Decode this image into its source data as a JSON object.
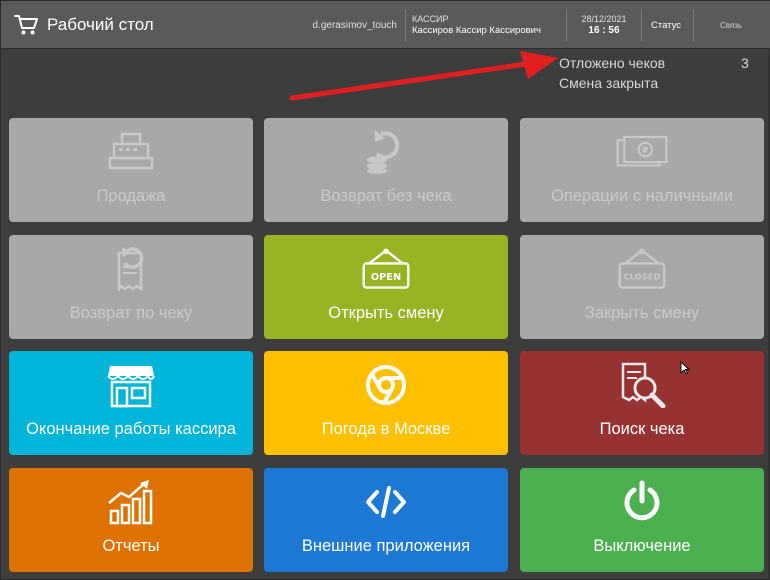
{
  "header": {
    "title": "Рабочий стол",
    "user_login": "d.gerasimov_touch",
    "role_label": "КАССИР",
    "role_person": "Кассиров Кассир Кассирович",
    "date": "28/12/2021",
    "time": "16 : 56",
    "status_label": "Статус",
    "link_label": "Связь"
  },
  "info": {
    "deferred_checks_label": "Отложено чеков",
    "deferred_checks_count": "3",
    "shift_status": "Смена закрыта"
  },
  "tiles": [
    {
      "label": "Продажа",
      "icon": "cash-register-icon",
      "color": "#a8a8a8",
      "enabled": false
    },
    {
      "label": "Возврат без чека",
      "icon": "coin-return-icon",
      "color": "#a8a8a8",
      "enabled": false
    },
    {
      "label": "Операции с наличными",
      "icon": "banknotes-icon",
      "color": "#a8a8a8",
      "enabled": false
    },
    {
      "label": "Возврат по чеку",
      "icon": "receipt-return-icon",
      "color": "#a8a8a8",
      "enabled": false
    },
    {
      "label": "Открыть смену",
      "icon": "open-sign-icon",
      "icon_text": "OPEN",
      "color": "#98b323",
      "enabled": true
    },
    {
      "label": "Закрыть смену",
      "icon": "closed-sign-icon",
      "icon_text": "CLOSED",
      "color": "#a8a8a8",
      "enabled": false
    },
    {
      "label": "Окончание работы кассира",
      "icon": "storefront-icon",
      "color": "#00b5d8",
      "enabled": true
    },
    {
      "label": "Погода в Москве",
      "icon": "chrome-icon",
      "color": "#ffc000",
      "enabled": true
    },
    {
      "label": "Поиск чека",
      "icon": "receipt-search-icon",
      "color": "#973232",
      "enabled": true
    },
    {
      "label": "Отчеты",
      "icon": "chart-growth-icon",
      "color": "#dd7200",
      "enabled": true
    },
    {
      "label": "Внешние приложения",
      "icon": "code-icon",
      "color": "#1e79d4",
      "enabled": true
    },
    {
      "label": "Выключение",
      "icon": "power-icon",
      "color": "#4caf50",
      "enabled": true
    }
  ]
}
